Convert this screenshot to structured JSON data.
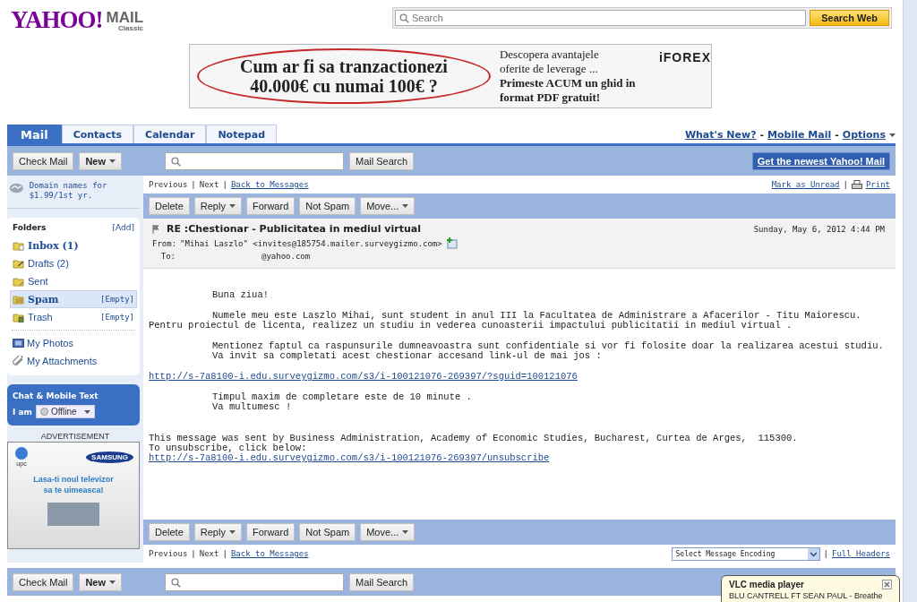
{
  "header": {
    "logo": {
      "brand": "YAHOO!",
      "product": "MAIL",
      "edition": "Classic"
    },
    "web_search": {
      "placeholder": "Search",
      "button": "Search Web"
    },
    "ad_banner": {
      "headline_lines": [
        "Cum ar fi sa tranzactionezi",
        "40.000€ cu numai 100€ ?"
      ],
      "text_lines": [
        "Descopera avantajele",
        "oferite de leverage ..."
      ],
      "bold_lines": [
        "Primeste ACUM un ghid in",
        "format PDF gratuit!"
      ],
      "brand": "iFOREX"
    }
  },
  "tabs": [
    {
      "label": "Mail",
      "selected": true
    },
    {
      "label": "Contacts",
      "selected": false
    },
    {
      "label": "Calendar",
      "selected": false
    },
    {
      "label": "Notepad",
      "selected": false
    }
  ],
  "top_links": {
    "items": [
      "What's New?",
      "Mobile Mail",
      "Options"
    ],
    "separator": "-"
  },
  "toolbar": {
    "check_mail": "Check Mail",
    "new": "New",
    "search_button": "Mail Search",
    "upgrade": "Get the newest Yahoo! Mail"
  },
  "sidebar": {
    "promo": "Domain names for $1.99/1st yr.",
    "folders_title": "Folders",
    "add": "[Add]",
    "folders": [
      {
        "name": "Inbox",
        "count": "(1)",
        "unread": true,
        "selected": false,
        "kind": "inbox"
      },
      {
        "name": "Drafts",
        "count": "(2)",
        "unread": false,
        "selected": false,
        "kind": "drafts"
      },
      {
        "name": "Sent",
        "unread": false,
        "selected": false,
        "kind": "sent"
      },
      {
        "name": "Spam",
        "action": "[Empty]",
        "unread": false,
        "selected": true,
        "kind": "spam"
      },
      {
        "name": "Trash",
        "action": "[Empty]",
        "unread": false,
        "selected": false,
        "kind": "trash"
      }
    ],
    "extras": [
      {
        "label": "My Photos",
        "kind": "photos"
      },
      {
        "label": "My Attachments",
        "kind": "attachments"
      }
    ],
    "chat": {
      "title": "Chat & Mobile Text",
      "label": "I am",
      "status": "Offline"
    },
    "ad": {
      "label": "ADVERTISEMENT",
      "brand": "upc",
      "partner": "SAMSUNG",
      "text_lines": [
        "Lasa-ti noul televizor",
        "sa te uimeasca!"
      ]
    }
  },
  "message": {
    "top_nav": {
      "items": [
        {
          "label": "Previous",
          "disabled": true
        },
        {
          "label": "Next",
          "disabled": true
        },
        {
          "label": "Back to Messages",
          "disabled": false
        }
      ],
      "separator": "|"
    },
    "links": {
      "mark": "Mark as Unread",
      "separator": "|",
      "print": "Print"
    },
    "top_actions": [
      {
        "label": "Delete",
        "has_menu": false
      },
      {
        "label": "Reply",
        "has_menu": true
      },
      {
        "label": "Forward",
        "has_menu": false
      },
      {
        "label": "Not Spam",
        "has_menu": false
      },
      {
        "label": "Move...",
        "has_menu": true
      }
    ],
    "subject": "RE :Chestionar - Publicitatea in mediul virtual",
    "date": "Sunday, May 6, 2012 4:44 PM",
    "from_label": "From:",
    "from": "\"Mihai Laszlo\" <invites@185754.mailer.surveygizmo.com>",
    "to_label": "To:",
    "to": "@yahoo.com",
    "body": [
      {
        "lines": [
          {
            "kind": "indented",
            "text": "Buna ziua!"
          }
        ]
      },
      {
        "lines": [
          {
            "kind": "indented",
            "text": "Numele meu este Laszlo Mihai, sunt student in anul III la Facultatea de Administrare a Afacerilor - Titu Maiorescu."
          },
          {
            "kind": "plain",
            "text": "Pentru proiectul de licenta, realizez un studiu in vederea cunoasterii impactului publicitatii in mediul virtual ."
          }
        ]
      },
      {
        "lines": [
          {
            "kind": "indented",
            "text": "Mentionez faptul ca raspunsurile dumneavoastra sunt confidentiale si vor fi folosite doar la realizarea acestui studiu."
          },
          {
            "kind": "indented",
            "text": "Va invit sa completati acest chestionar accesand link-ul de mai jos :"
          }
        ]
      },
      {
        "lines": [
          {
            "kind": "link",
            "text": "http://s-7a8100-i.edu.surveygizmo.com/s3/i-100121076-269397/?sguid=100121076"
          }
        ]
      },
      {
        "lines": [
          {
            "kind": "indented",
            "text": "Timpul maxim de completare este de 10 minute ."
          },
          {
            "kind": "indented",
            "text": "Va multumesc !"
          }
        ]
      },
      {
        "lines": [
          {
            "kind": "plain",
            "text": "This message was sent by Business Administration, Academy of Economic Studies, Bucharest, Curtea de Arges,  115300."
          },
          {
            "kind": "plain",
            "text": "To unsubscribe, click below:"
          },
          {
            "kind": "link",
            "text": "http://s-7a8100-i.edu.surveygizmo.com/s3/i-100121076-269397/unsubscribe"
          }
        ]
      }
    ],
    "bottom_actions": [
      {
        "label": "Delete",
        "has_menu": false
      },
      {
        "label": "Reply",
        "has_menu": true
      },
      {
        "label": "Forward",
        "has_menu": false
      },
      {
        "label": "Not Spam",
        "has_menu": false
      },
      {
        "label": "Move...",
        "has_menu": true
      }
    ],
    "bottom_nav": {
      "items": [
        {
          "label": "Previous",
          "disabled": true
        },
        {
          "label": "Next",
          "disabled": true
        },
        {
          "label": "Back to Messages",
          "disabled": false
        }
      ],
      "separator": "|"
    },
    "encoding": "Select Message Encoding",
    "encoding_separator": "|",
    "full_headers": "Full Headers"
  },
  "bottom_toolbar": {
    "check_mail": "Check Mail",
    "new": "New",
    "search_button": "Mail Search"
  },
  "notification": {
    "title": "VLC media player",
    "text": "BLU CANTRELL FT SEAN PAUL - Breathe"
  }
}
